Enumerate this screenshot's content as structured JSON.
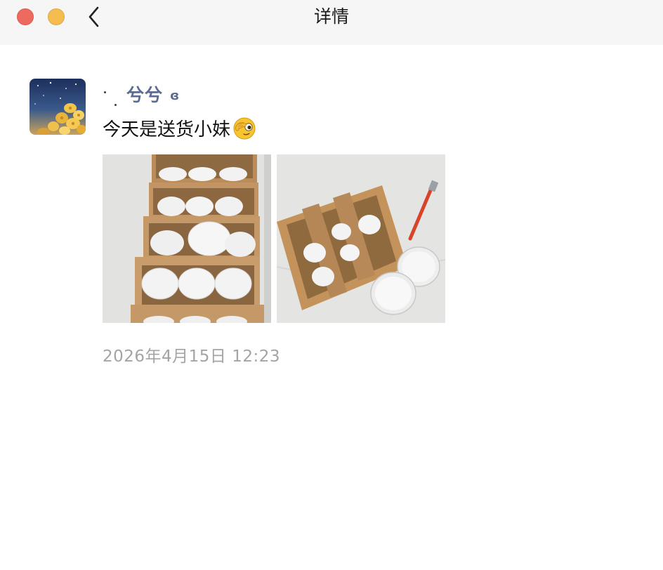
{
  "window": {
    "title": "详情",
    "controls": [
      "close",
      "minimize"
    ]
  },
  "nav": {
    "back_icon": "chevron-left-icon"
  },
  "post": {
    "author": {
      "name": "兮兮",
      "suffix": "ɞ",
      "avatar": "yellow-flowers-starry-sky"
    },
    "text": "今天是送货小妹",
    "emoji": "face-with-hand-over-eye-emoji",
    "photos": [
      {
        "description": "cardboard boxes packed with white plastic buckets"
      },
      {
        "description": "open cardboard box with white buckets and red tool"
      }
    ],
    "timestamp": "2026年4月15日 12:23"
  },
  "colors": {
    "titlebar_bg": "#f6f6f6",
    "username": "#5b6b92",
    "timestamp": "#a4a4a4",
    "close": "#ee6a5f",
    "minimize": "#f5bd4f"
  }
}
